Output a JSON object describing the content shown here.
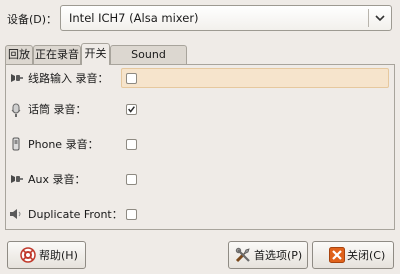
{
  "device": {
    "label": "设备(D)：",
    "selected_value": "Intel ICH7 (Alsa mixer)"
  },
  "tabs": [
    {
      "label": "回放"
    },
    {
      "label": "正在录音"
    },
    {
      "label": "开关",
      "active": true
    },
    {
      "label": "Sound Theme"
    }
  ],
  "switches": [
    {
      "label": "线路输入 录音：",
      "checked": false,
      "icon": "line-in-icon"
    },
    {
      "label": "话筒 录音：",
      "checked": true,
      "icon": "microphone-icon"
    },
    {
      "label": "Phone 录音：",
      "checked": false,
      "icon": "phone-icon"
    },
    {
      "label": "Aux 录音：",
      "checked": false,
      "icon": "aux-icon"
    },
    {
      "label": "Duplicate Front：",
      "checked": false,
      "icon": "speaker-icon"
    }
  ],
  "buttons": {
    "help": "帮助(H)",
    "preferences": "首选项(P)",
    "close": "关闭(C)"
  }
}
